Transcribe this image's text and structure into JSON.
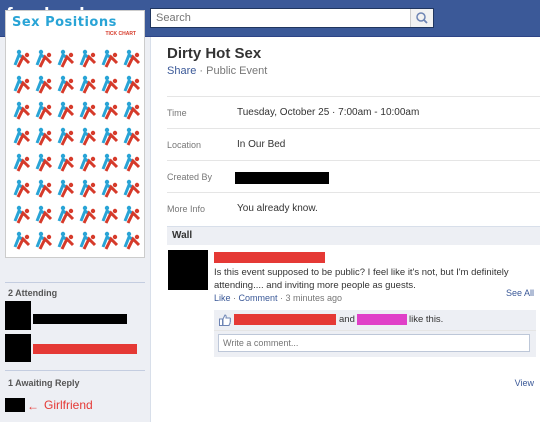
{
  "topbar": {
    "logo": "facebook",
    "search_placeholder": "Search"
  },
  "event": {
    "title": "Dirty Hot Sex",
    "share_label": "Share",
    "separator": " · ",
    "privacy": "Public Event",
    "details": [
      {
        "label": "Time",
        "value": "Tuesday, October 25 · 7:00am - 10:00am"
      },
      {
        "label": "Location",
        "value": "In Our Bed"
      },
      {
        "label": "Created By",
        "value": ""
      },
      {
        "label": "More Info",
        "value": "You already know."
      }
    ]
  },
  "poster": {
    "title": "Sex Positions",
    "subtitle": "TICK CHART"
  },
  "sidebar": {
    "attending_label": "2 Attending",
    "see_all": "See All",
    "awaiting_label": "1 Awaiting Reply",
    "view": "View",
    "girlfriend_arrow": "←",
    "girlfriend_label": "Girlfriend"
  },
  "wall": {
    "label": "Wall",
    "post_text": "Is this event supposed to be public? I feel like it's not, but I'm definitely attending.... and inviting more people as guests.",
    "like_link": "Like",
    "comment_link": "Comment",
    "dot": " · ",
    "time": "3 minutes ago",
    "and_text": "and",
    "like_suffix": "like this.",
    "comment_placeholder": "Write a comment..."
  },
  "colors": {
    "brand": "#3b5998",
    "redact_red": "#e53935",
    "redact_pink": "#e040c8"
  }
}
